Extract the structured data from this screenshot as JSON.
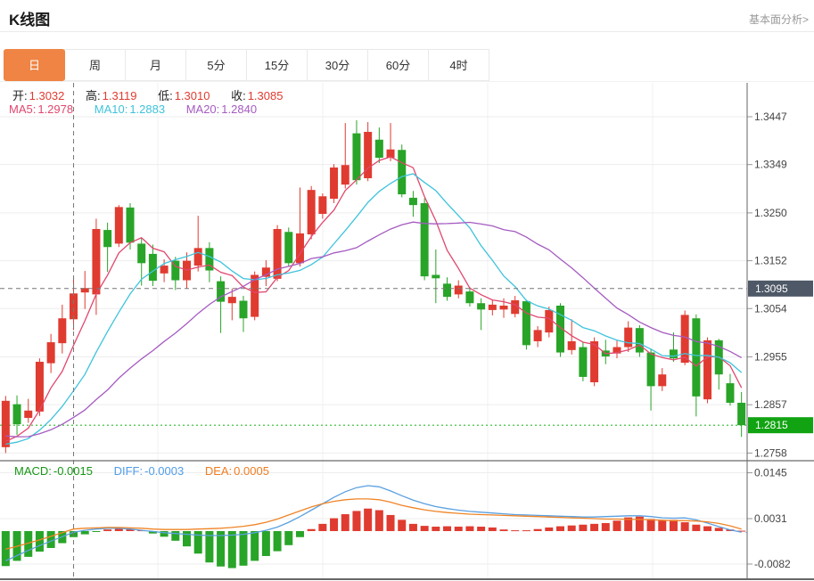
{
  "header": {
    "title": "K线图",
    "link": "基本面分析>"
  },
  "tabs": {
    "items": [
      "日",
      "周",
      "月",
      "5分",
      "15分",
      "30分",
      "60分",
      "4时"
    ],
    "active_index": 0
  },
  "legend": {
    "ohlc": [
      {
        "label": "开:",
        "value": "1.3032"
      },
      {
        "label": "高:",
        "value": "1.3119"
      },
      {
        "label": "低:",
        "value": "1.3010"
      },
      {
        "label": "收:",
        "value": "1.3085"
      }
    ],
    "ma": [
      {
        "label": "MA5:",
        "value": "1.2978"
      },
      {
        "label": "MA10:",
        "value": "1.2883"
      },
      {
        "label": "MA20:",
        "value": "1.2840"
      }
    ],
    "macd": [
      {
        "label": "MACD:",
        "value": "-0.0015"
      },
      {
        "label": "DIFF:",
        "value": "-0.0003"
      },
      {
        "label": "DEA:",
        "value": "0.0005"
      }
    ]
  },
  "chart_data": {
    "type": "candlestick",
    "title": "K线图 daily candlestick with MA5/MA10/MA20 overlays and MACD sub-chart",
    "price_axis": {
      "ticks": [
        1.3447,
        1.3349,
        1.325,
        1.3152,
        1.3054,
        1.2955,
        1.2857,
        1.2758
      ],
      "crosshair_price": 1.3095,
      "last_price": 1.2815
    },
    "crosshair_index": 6,
    "candles": [
      [
        1.277,
        1.2875,
        1.2758,
        1.2865
      ],
      [
        1.2858,
        1.2876,
        1.2795,
        1.2817
      ],
      [
        1.283,
        1.2869,
        1.282,
        1.2845
      ],
      [
        1.2843,
        1.2952,
        1.2834,
        1.2945
      ],
      [
        1.2942,
        1.3002,
        1.2922,
        1.2985
      ],
      [
        1.2983,
        1.3062,
        1.2962,
        1.3034
      ],
      [
        1.3032,
        1.3119,
        1.301,
        1.3085
      ],
      [
        1.3087,
        1.3131,
        1.3053,
        1.3096
      ],
      [
        1.3083,
        1.3238,
        1.3041,
        1.3217
      ],
      [
        1.3215,
        1.323,
        1.3129,
        1.318
      ],
      [
        1.3187,
        1.3266,
        1.318,
        1.3262
      ],
      [
        1.3261,
        1.327,
        1.3175,
        1.3189
      ],
      [
        1.3187,
        1.3199,
        1.3101,
        1.3147
      ],
      [
        1.3166,
        1.3185,
        1.31,
        1.3111
      ],
      [
        1.3126,
        1.3155,
        1.3108,
        1.3142
      ],
      [
        1.3152,
        1.316,
        1.3092,
        1.3112
      ],
      [
        1.3112,
        1.3169,
        1.3095,
        1.3152
      ],
      [
        1.3142,
        1.3244,
        1.313,
        1.3178
      ],
      [
        1.3178,
        1.319,
        1.3108,
        1.3132
      ],
      [
        1.311,
        1.312,
        1.3004,
        1.3068
      ],
      [
        1.3065,
        1.3095,
        1.303,
        1.3078
      ],
      [
        1.307,
        1.308,
        1.3006,
        1.3034
      ],
      [
        1.3037,
        1.313,
        1.303,
        1.3123
      ],
      [
        1.3119,
        1.3153,
        1.31,
        1.3138
      ],
      [
        1.3115,
        1.3225,
        1.311,
        1.3217
      ],
      [
        1.3211,
        1.322,
        1.314,
        1.3147
      ],
      [
        1.3147,
        1.3302,
        1.314,
        1.3208
      ],
      [
        1.3206,
        1.3305,
        1.3196,
        1.3297
      ],
      [
        1.3248,
        1.329,
        1.3238,
        1.3284
      ],
      [
        1.3279,
        1.335,
        1.327,
        1.3343
      ],
      [
        1.3308,
        1.3434,
        1.33,
        1.3348
      ],
      [
        1.3413,
        1.344,
        1.3308,
        1.3317
      ],
      [
        1.3321,
        1.3436,
        1.3315,
        1.3416
      ],
      [
        1.34,
        1.3425,
        1.3352,
        1.3363
      ],
      [
        1.3363,
        1.3434,
        1.3356,
        1.338
      ],
      [
        1.3379,
        1.339,
        1.3282,
        1.3288
      ],
      [
        1.3281,
        1.3295,
        1.3242,
        1.3266
      ],
      [
        1.327,
        1.328,
        1.3112,
        1.312
      ],
      [
        1.3123,
        1.3175,
        1.3065,
        1.3116
      ],
      [
        1.3105,
        1.3118,
        1.307,
        1.3078
      ],
      [
        1.3083,
        1.3112,
        1.3075,
        1.3101
      ],
      [
        1.3089,
        1.3098,
        1.3058,
        1.3065
      ],
      [
        1.3065,
        1.3075,
        1.301,
        1.3052
      ],
      [
        1.3051,
        1.3072,
        1.304,
        1.3062
      ],
      [
        1.3052,
        1.3075,
        1.3035,
        1.306
      ],
      [
        1.3043,
        1.308,
        1.3036,
        1.3071
      ],
      [
        1.3069,
        1.3072,
        1.297,
        1.2979
      ],
      [
        1.2987,
        1.3018,
        1.2975,
        1.301
      ],
      [
        1.3005,
        1.3058,
        1.2995,
        1.3051
      ],
      [
        1.306,
        1.3065,
        1.2955,
        1.2964
      ],
      [
        1.2969,
        1.3032,
        1.296,
        1.2987
      ],
      [
        1.2975,
        1.2985,
        1.2905,
        1.2914
      ],
      [
        1.2903,
        1.2995,
        1.2895,
        1.2987
      ],
      [
        1.2968,
        1.299,
        1.294,
        1.2956
      ],
      [
        1.2962,
        1.2988,
        1.2952,
        1.2975
      ],
      [
        1.2975,
        1.3028,
        1.2965,
        1.3015
      ],
      [
        1.3014,
        1.302,
        1.2955,
        1.2964
      ],
      [
        1.2964,
        1.2972,
        1.2845,
        1.2895
      ],
      [
        1.2895,
        1.2932,
        1.2885,
        1.2919
      ],
      [
        1.297,
        1.3005,
        1.2945,
        1.2952
      ],
      [
        1.2943,
        1.305,
        1.2938,
        1.3041
      ],
      [
        1.3034,
        1.3042,
        1.2833,
        1.2874
      ],
      [
        1.2868,
        1.2995,
        1.286,
        1.2989
      ],
      [
        1.2989,
        1.2992,
        1.2888,
        1.2919
      ],
      [
        1.2901,
        1.292,
        1.2855,
        1.2861
      ],
      [
        1.2861,
        1.2883,
        1.2791,
        1.2815
      ]
    ],
    "ma_periods": [
      5,
      10,
      20
    ],
    "ma_prehistory": [
      1.285,
      1.284,
      1.283,
      1.282,
      1.281,
      1.28,
      1.2795,
      1.279,
      1.2785,
      1.278,
      1.2775,
      1.2772,
      1.277,
      1.2768,
      1.2766,
      1.2764,
      1.2762,
      1.276,
      1.2758
    ],
    "macd": {
      "axis_ticks": [
        0.0145,
        0.0031,
        -0.0082
      ],
      "hist": [
        -0.0087,
        -0.0074,
        -0.0064,
        -0.0051,
        -0.0042,
        -0.003,
        -0.0015,
        -0.0008,
        -0.0002,
        0.0004,
        0.0006,
        0.0005,
        0.0002,
        -0.0006,
        -0.0014,
        -0.0024,
        -0.0038,
        -0.0056,
        -0.0078,
        -0.0088,
        -0.0092,
        -0.0086,
        -0.0074,
        -0.0062,
        -0.005,
        -0.0035,
        -0.0015,
        0.0005,
        0.0018,
        0.0032,
        0.0042,
        0.005,
        0.0056,
        0.0052,
        0.004,
        0.0028,
        0.0018,
        0.0013,
        0.0011,
        0.0012,
        0.0011,
        0.0012,
        0.0011,
        0.0009,
        0.0004,
        0.0002,
        0.0002,
        0.0005,
        0.0009,
        0.0012,
        0.0014,
        0.0016,
        0.0018,
        0.002,
        0.0026,
        0.0034,
        0.0036,
        0.003,
        0.0026,
        0.0028,
        0.0022,
        0.0016,
        0.0012,
        0.0008,
        0.0004,
        0.0001
      ],
      "diff": [
        -0.0074,
        -0.0061,
        -0.0048,
        -0.0036,
        -0.0025,
        -0.0014,
        -0.0003,
        0.0002,
        0.0005,
        0.0007,
        0.0007,
        0.0005,
        0.0002,
        -0.0001,
        -0.0004,
        -0.0006,
        -0.0008,
        -0.001,
        -0.0011,
        -0.0011,
        -0.001,
        -0.0008,
        -0.0004,
        0.0002,
        0.001,
        0.0022,
        0.0036,
        0.0052,
        0.0068,
        0.0084,
        0.0098,
        0.0108,
        0.0113,
        0.011,
        0.01,
        0.0088,
        0.0077,
        0.0068,
        0.0061,
        0.0056,
        0.0052,
        0.0049,
        0.0047,
        0.0045,
        0.0043,
        0.0041,
        0.004,
        0.0039,
        0.0038,
        0.0037,
        0.0036,
        0.0035,
        0.0035,
        0.0036,
        0.0037,
        0.0038,
        0.0038,
        0.0036,
        0.0033,
        0.0032,
        0.0033,
        0.0028,
        0.002,
        0.0011,
        0.0003,
        -0.0003
      ],
      "dea": [
        -0.0045,
        -0.0038,
        -0.003,
        -0.0022,
        -0.0013,
        -0.0004,
        0.0005,
        0.0007,
        0.0008,
        0.0009,
        0.0009,
        0.0008,
        0.0007,
        0.0005,
        0.0004,
        0.0004,
        0.0004,
        0.0005,
        0.0006,
        0.0007,
        0.0009,
        0.0012,
        0.0016,
        0.0022,
        0.003,
        0.004,
        0.005,
        0.006,
        0.0068,
        0.0074,
        0.0078,
        0.008,
        0.008,
        0.0078,
        0.0072,
        0.0064,
        0.0058,
        0.0053,
        0.0049,
        0.0046,
        0.0044,
        0.0042,
        0.0041,
        0.004,
        0.0039,
        0.0038,
        0.0037,
        0.0036,
        0.0035,
        0.0034,
        0.0033,
        0.0032,
        0.0031,
        0.003,
        0.003,
        0.0029,
        0.0029,
        0.0028,
        0.0027,
        0.0026,
        0.0026,
        0.0025,
        0.0023,
        0.0019,
        0.0013,
        0.0005
      ]
    },
    "colors": {
      "up": "#e03b30",
      "down": "#28a428",
      "ma5": "#e0476e",
      "ma10": "#3fc3dc",
      "ma20": "#a55bc1",
      "diff": "#5aa0e0",
      "dea": "#ef8426",
      "crosshair": "#777777",
      "last_price_line": "#2db82d",
      "badge_dark": "#4e5866",
      "badge_green": "#12a312",
      "grid": "#ededed",
      "vgrid": "#f0f0f0",
      "axis_text": "#444444",
      "selected_tab": "#ef8444"
    },
    "layout": {
      "grid": true,
      "legend_position": "top-left",
      "price_axis_side": "right"
    }
  }
}
